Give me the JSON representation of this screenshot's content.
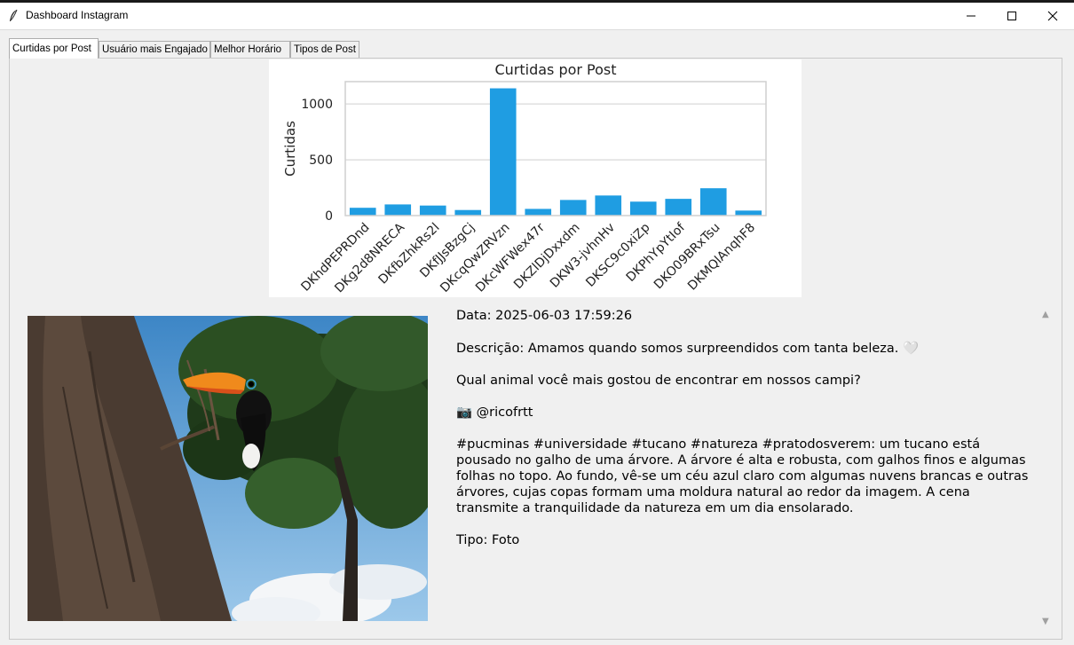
{
  "window": {
    "title": "Dashboard Instagram"
  },
  "tabs": [
    "Curtidas por Post",
    "Usuário mais Engajado",
    "Melhor Horário",
    "Tipos de Post"
  ],
  "chart_data": {
    "type": "bar",
    "title": "Curtidas por Post",
    "xlabel": "",
    "ylabel": "Curtidas",
    "categories": [
      "DKhdPEPRDnd",
      "DKg2d8NRECA",
      "DKfbZhkRs2l",
      "DKfJJsBzgCj",
      "DKcqQwZRVzn",
      "DKcWFWex47r",
      "DKZlDjDxxdm",
      "DKW3-jvhnHv",
      "DKSC9c0xiZp",
      "DKPhYpYtIof",
      "DKO09BRxTsu",
      "DKMQlAnqhF8"
    ],
    "values": [
      70,
      100,
      90,
      50,
      1140,
      60,
      140,
      180,
      125,
      150,
      245,
      45
    ],
    "ylim": [
      0,
      1200
    ],
    "yticks": [
      0,
      500,
      1000
    ],
    "grid": true,
    "bar_color": "#1f9de2"
  },
  "post": {
    "date": "Data: 2025-06-03 17:59:26",
    "description": "Descrição: Amamos quando somos surpreendidos com tanta beleza. 🤍",
    "question": "Qual animal você mais gostou de encontrar em nossos campi?",
    "credit": "📷 @ricofrtt",
    "hashtags": "#pucminas #universidade #tucano #natureza #pratodosverem: um tucano está pousado no galho de uma árvore. A árvore é alta e robusta, com galhos finos e algumas folhas no topo. Ao fundo, vê-se um céu azul claro com algumas nuvens brancas e outras árvores, cujas copas formam uma moldura natural ao redor da imagem. A cena transmite a tranquilidade da natureza em um dia ensolarado.",
    "type": "Tipo: Foto"
  },
  "icons": {
    "app": "feather-icon",
    "minimize": "minimize-icon",
    "maximize": "maximize-icon",
    "close": "close-icon",
    "scroll_up": "scroll-up-arrow-icon",
    "scroll_down": "scroll-down-arrow-icon"
  }
}
